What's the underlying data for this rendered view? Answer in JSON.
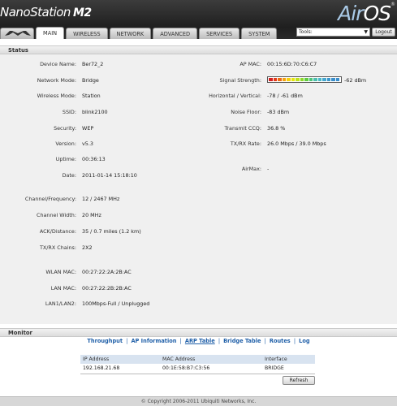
{
  "header": {
    "brand": "NanoStation",
    "brand_model": "M2",
    "airos_air": "Air",
    "airos_os": "OS",
    "tabs": [
      "MAIN",
      "WIRELESS",
      "NETWORK",
      "ADVANCED",
      "SERVICES",
      "SYSTEM"
    ],
    "tools_value": "Tools:",
    "logout_label": "Logout"
  },
  "status": {
    "title": "Status",
    "left": [
      {
        "label": "Device Name:",
        "value": "Ber72_2"
      },
      {
        "label": "Network Mode:",
        "value": "Bridge"
      },
      {
        "label": "Wireless Mode:",
        "value": "Station"
      },
      {
        "label": "SSID:",
        "value": "blink2100"
      },
      {
        "label": "Security:",
        "value": "WEP"
      },
      {
        "label": "Version:",
        "value": "v5.3"
      },
      {
        "label": "Uptime:",
        "value": "00:36:13"
      },
      {
        "label": "Date:",
        "value": "2011-01-14 15:18:10"
      },
      {
        "label": "Channel/Frequency:",
        "value": "12 / 2467 MHz"
      },
      {
        "label": "Channel Width:",
        "value": "20 MHz"
      },
      {
        "label": "ACK/Distance:",
        "value": "35 / 0.7 miles (1.2 km)"
      },
      {
        "label": "TX/RX Chains:",
        "value": "2X2"
      },
      {
        "label": "WLAN MAC:",
        "value": "00:27:22:2A:2B:AC"
      },
      {
        "label": "LAN MAC:",
        "value": "00:27:22:2B:2B:AC"
      },
      {
        "label": "LAN1/LAN2:",
        "value": "100Mbps-Full / Unplugged"
      }
    ],
    "right": [
      {
        "label": "AP MAC:",
        "value": "00:15:6D:70:C6:C7"
      },
      {
        "label": "Signal Strength:",
        "value": "-62 dBm"
      },
      {
        "label": "Horizontal / Vertical:",
        "value": "-78 / -61 dBm"
      },
      {
        "label": "Noise Floor:",
        "value": "-83 dBm"
      },
      {
        "label": "Transmit CCQ:",
        "value": "36.8 %"
      },
      {
        "label": "TX/RX Rate:",
        "value": "26.0 Mbps / 39.0 Mbps"
      },
      {
        "label": "AirMax:",
        "value": "-"
      }
    ],
    "signal_colors": [
      "#d42020",
      "#e23a1a",
      "#ec6a12",
      "#f3a10e",
      "#f5d00a",
      "#e6e60c",
      "#bde21a",
      "#8dd82a",
      "#5ecc40",
      "#4ec47a",
      "#4cbfae",
      "#4bb7c9",
      "#45a7cf",
      "#3b96cc",
      "#3a8ecb",
      "#3a8ecb"
    ],
    "signal_fill": 1.0
  },
  "monitor": {
    "title": "Monitor",
    "links": [
      "Throughput",
      "AP Information",
      "ARP Table",
      "Bridge Table",
      "Routes",
      "Log"
    ],
    "table": {
      "headers": [
        "IP Address",
        "MAC Address",
        "Interface"
      ],
      "rows": [
        [
          "192.168.21.68",
          "00:1E:58:B7:C3:56",
          "BRIDGE"
        ]
      ]
    },
    "refresh_label": "Refresh"
  },
  "footer": "© Copyright 2006-2011 Ubiquiti Networks, Inc."
}
